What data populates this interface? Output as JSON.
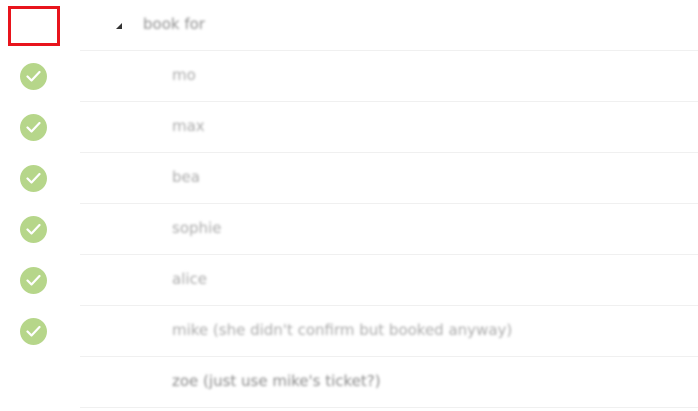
{
  "parent": {
    "title": "book for",
    "expanded": true
  },
  "children": [
    {
      "title": "mo",
      "done": true
    },
    {
      "title": "max",
      "done": true
    },
    {
      "title": "bea",
      "done": true
    },
    {
      "title": "sophie",
      "done": true
    },
    {
      "title": "alice",
      "done": true
    },
    {
      "title": "mike (she didn't confirm but booked anyway)",
      "done": true
    },
    {
      "title": "zoe (just use mike's ticket?)",
      "done": false
    }
  ],
  "colors": {
    "check": "#b6d68a",
    "selection": "#e8141c",
    "separator": "#f0f0f0"
  },
  "icons": {
    "done": "checkmark-icon",
    "toggle": "triangle-down-icon"
  }
}
